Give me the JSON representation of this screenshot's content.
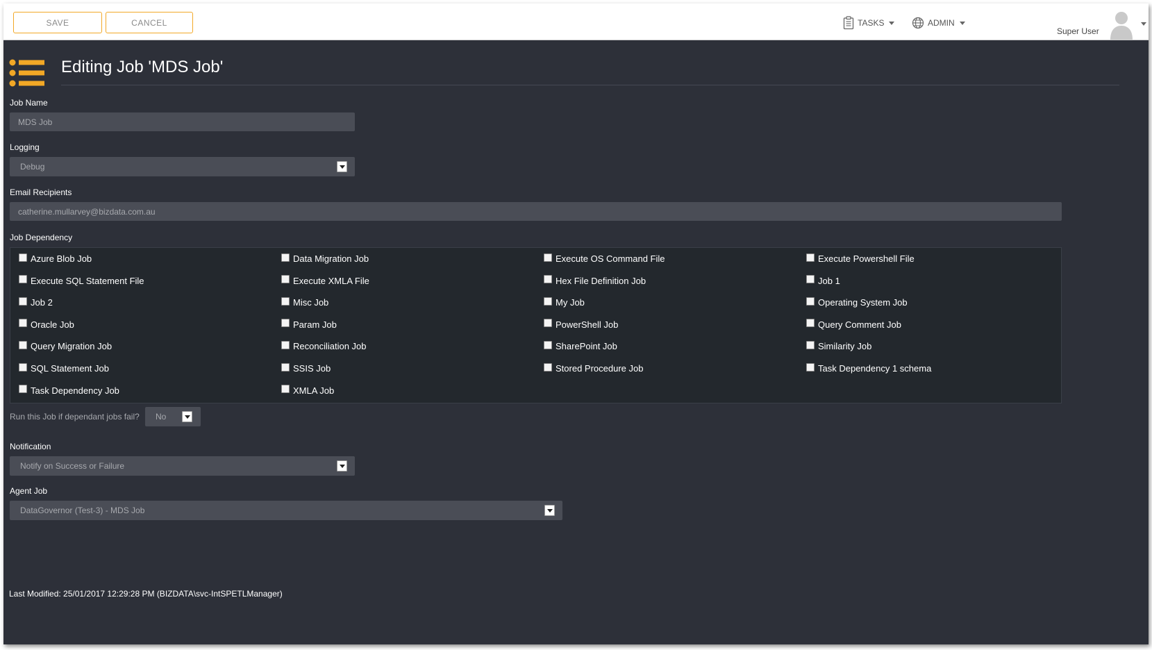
{
  "toolbar": {
    "save_label": "SAVE",
    "cancel_label": "CANCEL",
    "tasks_label": "TASKS",
    "admin_label": "ADMIN",
    "user_name": "Super User"
  },
  "page": {
    "title": "Editing Job 'MDS Job'"
  },
  "form": {
    "job_name_label": "Job Name",
    "job_name_value": "MDS Job",
    "logging_label": "Logging",
    "logging_value": "Debug",
    "email_label": "Email Recipients",
    "email_value": "catherine.mullarvey@bizdata.com.au",
    "dependency_label": "Job Dependency",
    "dependencies": [
      "Azure Blob Job",
      "Data Migration Job",
      "Execute OS Command File",
      "Execute Powershell File",
      "Execute SQL Statement File",
      "Execute XMLA File",
      "Hex File Definition Job",
      "Job 1",
      "Job 2",
      "Misc Job",
      "My Job",
      "Operating System Job",
      "Oracle Job",
      "Param Job",
      "PowerShell Job",
      "Query Comment Job",
      "Query Migration Job",
      "Reconciliation Job",
      "SharePoint Job",
      "Similarity Job",
      "SQL Statement Job",
      "SSIS Job",
      "Stored Procedure Job",
      "Task Dependency 1 schema",
      "Task Dependency Job",
      "XMLA Job"
    ],
    "run_if_fail_label": "Run this Job if dependant jobs fail?",
    "run_if_fail_value": "No",
    "notification_label": "Notification",
    "notification_value": "Notify on Success or Failure",
    "agent_job_label": "Agent Job",
    "agent_job_value": "DataGovernor (Test-3) - MDS Job"
  },
  "footer": {
    "last_modified": "Last Modified: 25/01/2017 12:29:28 PM (BIZDATA\\svc-IntSPETLManager)"
  },
  "colors": {
    "accent": "#f2a826",
    "background": "#2d3039",
    "field": "#4a4d56",
    "panel": "#23282d"
  },
  "icons": {
    "page": "list-icon",
    "tasks": "clipboard-icon",
    "admin": "globe-icon",
    "user": "avatar-icon"
  }
}
